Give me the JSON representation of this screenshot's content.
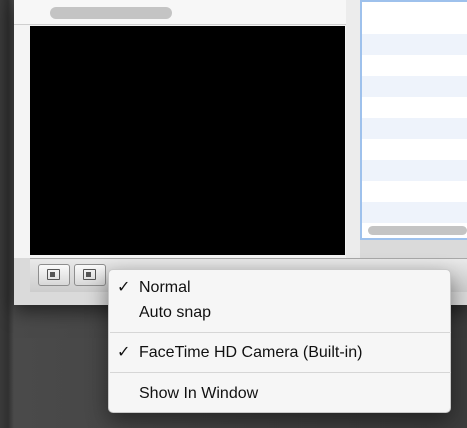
{
  "menu": {
    "check_mark": "✓",
    "items": [
      {
        "label": "Normal",
        "checked": true
      },
      {
        "label": "Auto snap",
        "checked": false
      },
      {
        "label": "FaceTime HD Camera (Built-in)",
        "checked": true
      },
      {
        "label": "Show In Window",
        "checked": false
      }
    ]
  },
  "colors": {
    "selection_border": "#9ec1ec",
    "preview_background": "#000000",
    "menu_background": "#f6f6f6"
  },
  "toolbar": {
    "buttons": [
      "display-mode-icon",
      "mode-icon"
    ]
  }
}
